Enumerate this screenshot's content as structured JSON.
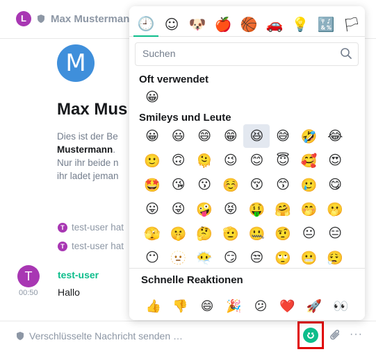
{
  "header": {
    "avatar_letter": "L",
    "room_title": "Max Musterman"
  },
  "room_intro": {
    "avatar_letter": "M",
    "name": "Max Mus",
    "desc_line1": "Dies ist der Be",
    "desc_bold": "Mustermann",
    "desc_after_bold": ".",
    "desc_line3": "Nur ihr beide n",
    "desc_line4": "ihr ladet jeman"
  },
  "events": [
    {
      "avatar": "T",
      "text": "test-user hat"
    },
    {
      "avatar": "T",
      "text": "test-user hat"
    }
  ],
  "message": {
    "avatar": "T",
    "time": "00:50",
    "sender": "test-user",
    "body": "Hallo"
  },
  "composer": {
    "placeholder": "Verschlüsselte Nachricht senden …",
    "more": "···",
    "attach": "📎"
  },
  "picker": {
    "categories": [
      {
        "name": "Oft verwendet",
        "glyph": "🕘",
        "icon": "clock-icon"
      },
      {
        "name": "Smileys und Leute",
        "glyph": "☺",
        "icon": "smiley-icon"
      },
      {
        "name": "Tiere",
        "glyph": "🐶",
        "icon": "dog-icon"
      },
      {
        "name": "Essen",
        "glyph": "🍎",
        "icon": "apple-icon"
      },
      {
        "name": "Aktivitäten",
        "glyph": "🏀",
        "icon": "ball-icon"
      },
      {
        "name": "Reisen",
        "glyph": "🚗",
        "icon": "car-icon"
      },
      {
        "name": "Objekte",
        "glyph": "💡",
        "icon": "bulb-icon"
      },
      {
        "name": "Symbole",
        "glyph": "🔣",
        "icon": "symbols-icon"
      },
      {
        "name": "Flaggen",
        "glyph": "🏳",
        "icon": "flag-icon"
      }
    ],
    "search_placeholder": "Suchen",
    "frequent_title": "Oft verwendet",
    "frequent": [
      "😀"
    ],
    "smileys_title": "Smileys und Leute",
    "smileys": [
      "😀",
      "😃",
      "😄",
      "😁",
      "😆",
      "😅",
      "🤣",
      "😂",
      "🙂",
      "🙃",
      "🫠",
      "😉",
      "😊",
      "😇",
      "🥰",
      "😍",
      "🤩",
      "😘",
      "😗",
      "☺️",
      "😚",
      "😙",
      "🥲",
      "😋",
      "😛",
      "😜",
      "🤪",
      "😝",
      "🤑",
      "🤗",
      "🤭",
      "🫢",
      "🫣",
      "🤫",
      "🤔",
      "🫡",
      "🤐",
      "🤨",
      "😐",
      "😑",
      "😶",
      "🫥",
      "😶‍🌫️",
      "😏",
      "😒",
      "🙄",
      "😬",
      "😮‍💨"
    ],
    "quick_title": "Schnelle Reaktionen",
    "quick": [
      "👍",
      "👎",
      "😄",
      "🎉",
      "😕",
      "❤️",
      "🚀",
      "👀"
    ]
  }
}
